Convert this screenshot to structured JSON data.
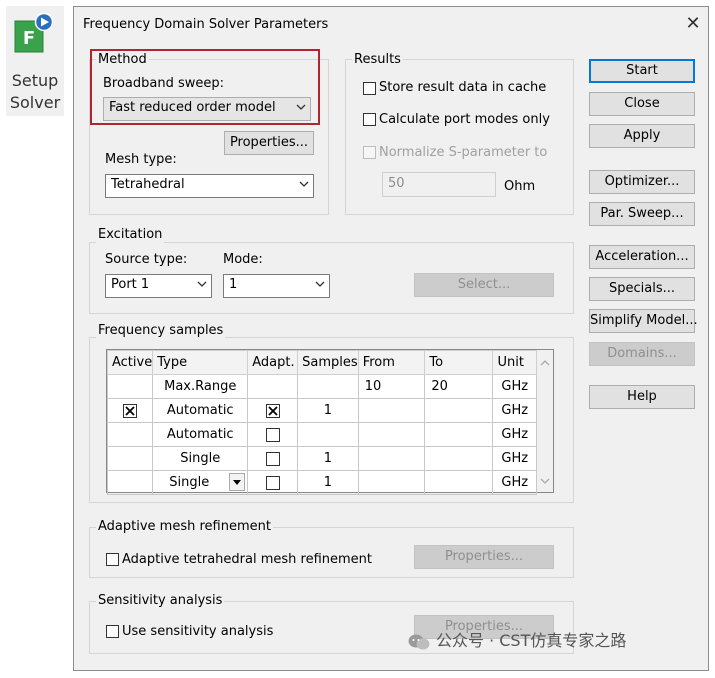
{
  "toolbar": {
    "setup_solver_line1": "Setup",
    "setup_solver_line2": "Solver",
    "icon_letter": "F"
  },
  "dialog": {
    "title": "Frequency Domain Solver Parameters",
    "method": {
      "legend": "Method",
      "broadband_label": "Broadband sweep:",
      "broadband_value": "Fast reduced order model",
      "properties_label": "Properties...",
      "mesh_type_label": "Mesh type:",
      "mesh_type_value": "Tetrahedral"
    },
    "results": {
      "legend": "Results",
      "store_label": "Store result data in cache",
      "calc_port_label": "Calculate port modes only",
      "normalize_label": "Normalize S-parameter to",
      "normalize_value": "50",
      "normalize_unit": "Ohm"
    },
    "excitation": {
      "legend": "Excitation",
      "source_type_label": "Source type:",
      "source_type_value": "Port 1",
      "mode_label": "Mode:",
      "mode_value": "1",
      "select_label": "Select..."
    },
    "frequency_samples": {
      "legend": "Frequency samples",
      "columns": [
        "Active",
        "Type",
        "Adapt.",
        "Samples",
        "From",
        "To",
        "Unit"
      ],
      "rows": [
        {
          "active": "",
          "type": "Max.Range",
          "adapt": "",
          "samples": "",
          "from": "10",
          "to": "20",
          "unit": "GHz"
        },
        {
          "active": "checked",
          "type": "Automatic",
          "adapt": "checked",
          "samples": "1",
          "from": "",
          "to": "",
          "unit": "GHz"
        },
        {
          "active": "",
          "type": "Automatic",
          "adapt": "unchecked",
          "samples": "",
          "from": "",
          "to": "",
          "unit": "GHz"
        },
        {
          "active": "",
          "type": "Single",
          "adapt": "unchecked",
          "samples": "1",
          "from": "",
          "to": "",
          "unit": "GHz"
        },
        {
          "active": "",
          "type": "Single",
          "adapt": "unchecked",
          "samples": "1",
          "from": "",
          "to": "",
          "unit": "GHz"
        }
      ]
    },
    "adaptive_mesh": {
      "legend": "Adaptive mesh refinement",
      "checkbox_label": "Adaptive tetrahedral mesh refinement",
      "properties_label": "Properties..."
    },
    "sensitivity": {
      "legend": "Sensitivity analysis",
      "checkbox_label": "Use sensitivity analysis",
      "properties_label": "Properties..."
    },
    "buttons": {
      "start": "Start",
      "close": "Close",
      "apply": "Apply",
      "optimizer": "Optimizer...",
      "par_sweep": "Par. Sweep...",
      "acceleration": "Acceleration...",
      "specials": "Specials...",
      "simplify_model": "Simplify Model...",
      "domains": "Domains...",
      "help": "Help"
    }
  },
  "watermark": {
    "text": "公众号 · CST仿真专家之路"
  },
  "colors": {
    "accent": "#0078d7",
    "highlight": "#b0262f",
    "dialog_bg": "#f0f0f0"
  }
}
